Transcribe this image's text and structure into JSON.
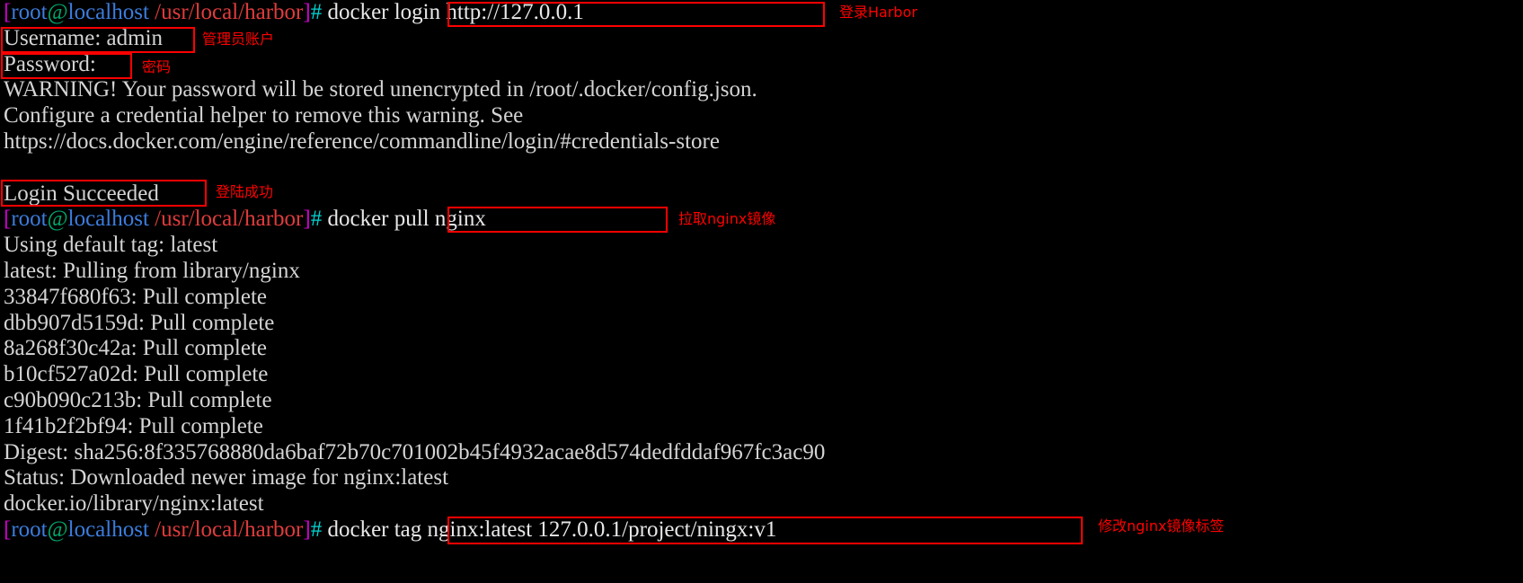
{
  "terminal": {
    "title": "docker login and pull nginx terminal session",
    "background_color": "#000000",
    "prompt": {
      "open_bracket": "[",
      "user": "root",
      "at": "@",
      "host": "localhost",
      "space": " ",
      "path": "/usr/local/harbor",
      "close_bracket": "]",
      "hash": "#",
      "colors": {
        "bracket": "#d000d0",
        "user": "#3b7ddd",
        "at": "#00a86b",
        "host": "#3b7ddd",
        "path": "#e03c3c",
        "hash": "#00d4d4",
        "output": "#d4d4d4",
        "annotation": "#ff0000"
      }
    },
    "lines": {
      "l01_cmd": "docker login http://127.0.0.1",
      "l02": "Username: admin",
      "l03": "Password:",
      "l04": "WARNING! Your password will be stored unencrypted in /root/.docker/config.json.",
      "l05": "Configure a credential helper to remove this warning. See",
      "l06": "https://docs.docker.com/engine/reference/commandline/login/#credentials-store",
      "l07": "",
      "l08": "Login Succeeded",
      "l09_cmd": "docker pull nginx",
      "l10": "Using default tag: latest",
      "l11": "latest: Pulling from library/nginx",
      "l12": "33847f680f63: Pull complete",
      "l13": "dbb907d5159d: Pull complete",
      "l14": "8a268f30c42a: Pull complete",
      "l15": "b10cf527a02d: Pull complete",
      "l16": "c90b090c213b: Pull complete",
      "l17": "1f41b2f2bf94: Pull complete",
      "l18": "Digest: sha256:8f335768880da6baf72b70c701002b45f4932acae8d574dedfddaf967fc3ac90",
      "l19": "Status: Downloaded newer image for nginx:latest",
      "l20": "docker.io/library/nginx:latest",
      "l21_cmd": "docker tag nginx:latest 127.0.0.1/project/ningx:v1"
    },
    "annotations": {
      "a1": "登录Harbor",
      "a2": "管理员账户",
      "a3": "密码",
      "a4": "登陆成功",
      "a5": "拉取nginx镜像",
      "a6": "修改nginx镜像标签"
    }
  }
}
